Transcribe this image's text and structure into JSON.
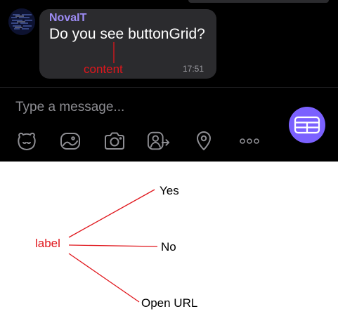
{
  "chat": {
    "sender": "NovaIT",
    "message": "Do you see buttonGrid?",
    "time": "17:51",
    "input_placeholder": "Type a message...",
    "toolbar_icons": [
      "sticker-icon",
      "gif-icon",
      "camera-icon",
      "share-contact-icon",
      "location-icon",
      "more-icon"
    ],
    "grid_button_icon": "button-grid-icon",
    "accent_color": "#7b61ff",
    "sender_color": "#9d8cf5"
  },
  "annotations": {
    "content_label": "content",
    "label_label": "label",
    "button_labels": [
      "Yes",
      "No",
      "Open URL"
    ],
    "annotation_color": "#e0161c"
  }
}
